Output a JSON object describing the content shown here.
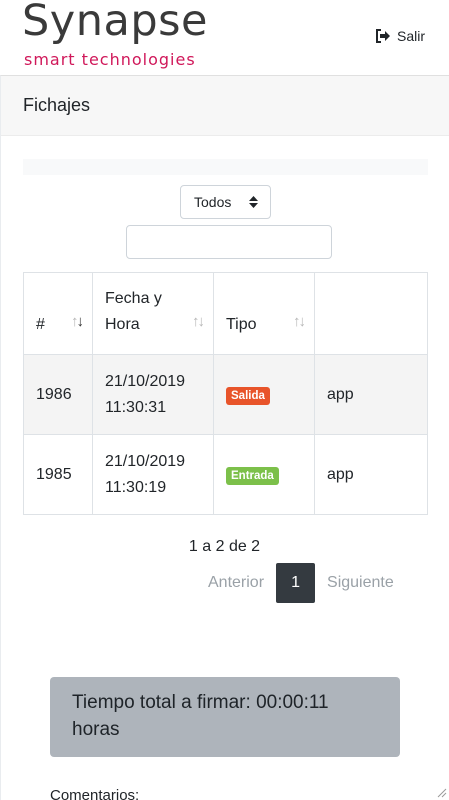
{
  "brand": {
    "name": "Synapse",
    "tagline": "smart technologies"
  },
  "header": {
    "logout_label": "Salir"
  },
  "card": {
    "title": "Fichajes"
  },
  "filter": {
    "selected": "Todos",
    "options": [
      "Todos"
    ]
  },
  "search": {
    "value": "",
    "placeholder": ""
  },
  "table": {
    "headers": [
      "#",
      "Fecha y Hora",
      "Tipo"
    ],
    "header_lines": {
      "fecha_1": "Fecha y",
      "fecha_2": "Hora"
    },
    "rows": [
      {
        "id": "1986",
        "date": "21/10/2019",
        "time": "11:30:31",
        "type": "Salida",
        "source": "app"
      },
      {
        "id": "1985",
        "date": "21/10/2019",
        "time": "11:30:19",
        "type": "Entrada",
        "source": "app"
      }
    ]
  },
  "pagination": {
    "info": "1 a 2 de 2",
    "prev_label": "Anterior",
    "current_page": "1",
    "next_label": "Siguiente"
  },
  "summary": {
    "total_text": "Tiempo total a firmar: 00:00:11 horas"
  },
  "comments": {
    "label": "Comentarios:"
  },
  "colors": {
    "brand_tag": "#d0185a",
    "badge_out": "#e8542a",
    "badge_in": "#7cc04a",
    "pager_active": "#343a40",
    "summary_bg": "#aeb4bb"
  }
}
